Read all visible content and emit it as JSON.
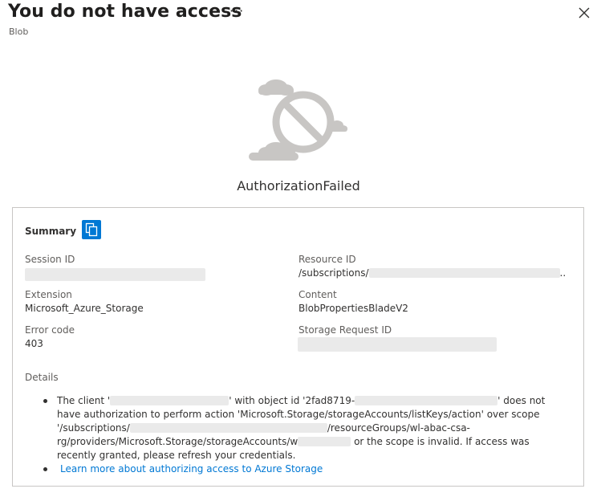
{
  "header": {
    "title": "You do not have access",
    "subtitle": "Blob",
    "more_label": "···"
  },
  "error": {
    "title": "AuthorizationFailed"
  },
  "summary": {
    "label": "Summary",
    "session_id_label": "Session ID",
    "resource_id_label": "Resource ID",
    "resource_id_prefix": "/subscriptions/",
    "resource_id_suffix": "..",
    "extension_label": "Extension",
    "extension_value": "Microsoft_Azure_Storage",
    "content_label": "Content",
    "content_value": "BlobPropertiesBladeV2",
    "error_code_label": "Error code",
    "error_code_value": "403",
    "storage_request_id_label": "Storage Request ID"
  },
  "details": {
    "label": "Details",
    "seg1": "The client '",
    "seg2": "' with object id '2fad8719-",
    "seg3": "' does not have authorization to perform action 'Microsoft.Storage/storageAccounts/listKeys/action' over scope '/subscriptions/",
    "seg4": "/resourceGroups/wl-abac-csa-rg/providers/Microsoft.Storage/storageAccounts/w",
    "seg5": " or the scope is invalid. If access was recently granted, please refresh your credentials.",
    "link_text": "Learn more about authorizing access to Azure Storage"
  },
  "colors": {
    "accent": "#0078d4",
    "redaction": "#eaeaea",
    "illustration_gray": "#c8c6c4"
  },
  "icons": [
    "more-icon",
    "close-icon",
    "copy-icon",
    "no-access-icon",
    "cloud-icon"
  ]
}
